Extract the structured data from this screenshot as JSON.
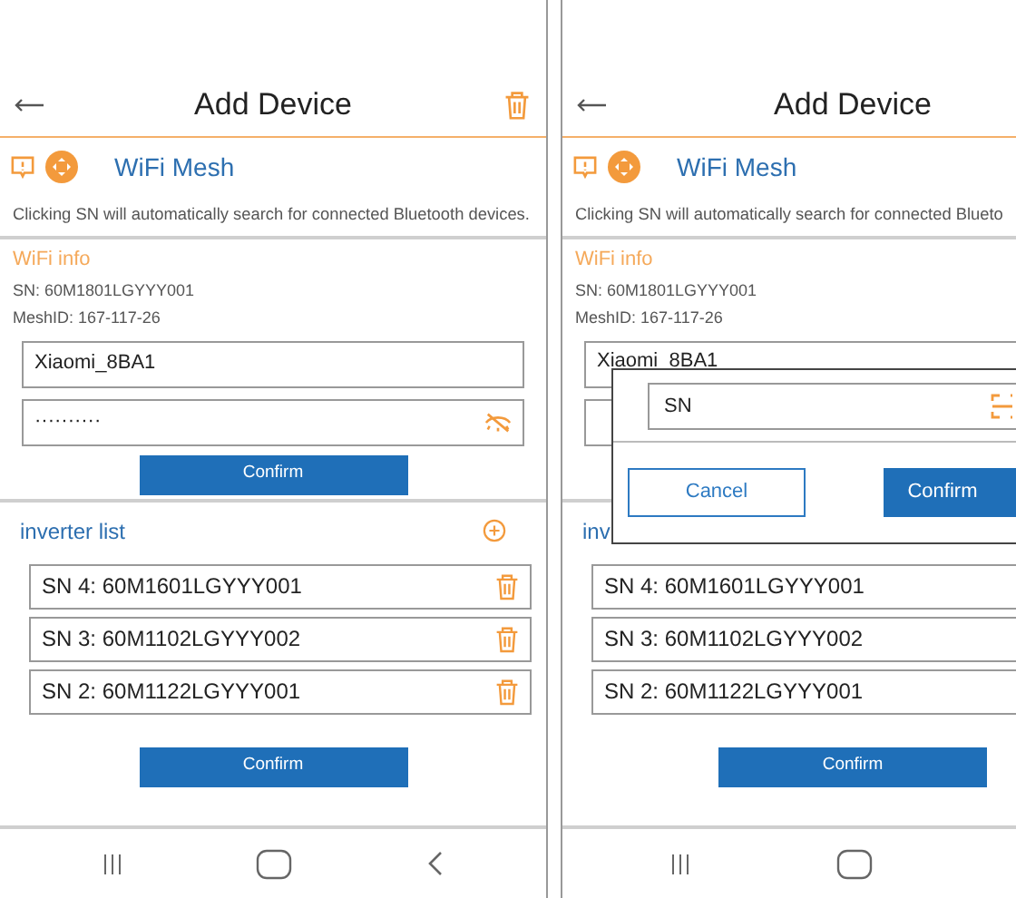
{
  "screens": [
    {
      "title": "Add Device",
      "mesh_label": "WiFi Mesh",
      "hint": "Clicking SN will automatically search for connected Bluetooth devices.",
      "wifi_heading": "WiFi info",
      "sn_line": "SN: 60M1801LGYYY001",
      "mesh_id_line": "MeshID: 167-117-26",
      "ssid": "Xiaomi_8BA1",
      "password": "··········",
      "wifi_confirm": "Confirm",
      "inverter_heading": "inverter list",
      "inverters": [
        {
          "label": "SN 4: 60M1601LGYYY001"
        },
        {
          "label": "SN 3: 60M1102LGYYY002"
        },
        {
          "label": "SN 2: 60M1122LGYYY001"
        }
      ],
      "list_confirm": "Confirm"
    },
    {
      "title": "Add Device",
      "mesh_label": "WiFi Mesh",
      "hint": "Clicking SN will automatically search for connected Blueto",
      "wifi_heading": "WiFi info",
      "sn_line": "SN: 60M1801LGYYY001",
      "mesh_id_line": "MeshID: 167-117-26",
      "ssid": "Xiaomi_8BA1",
      "inverter_heading": "inv",
      "inverters": [
        {
          "label": "SN 4: 60M1601LGYYY001"
        },
        {
          "label": "SN 3: 60M1102LGYYY002"
        },
        {
          "label": "SN 2: 60M1122LGYYY001"
        }
      ],
      "list_confirm": "Confirm",
      "dialog": {
        "placeholder": "SN",
        "cancel": "Cancel",
        "confirm": "Confirm"
      }
    }
  ]
}
